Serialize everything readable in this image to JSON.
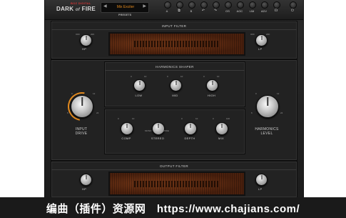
{
  "header": {
    "brand": "BOZ DIGITAL",
    "product": "DARK",
    "product_of": "of",
    "product_end": "FIRE",
    "preset": {
      "prev": "◀",
      "next": "▶",
      "name": "Mix Exciter",
      "label": "PRESETS"
    },
    "toolbar": [
      {
        "name": "a",
        "label": "A"
      },
      {
        "name": "copy",
        "label": "⧉"
      },
      {
        "name": "b",
        "label": "B"
      },
      {
        "name": "undo",
        "label": "↶"
      },
      {
        "name": "redo",
        "label": "↷"
      },
      {
        "name": "os",
        "label": "OS"
      },
      {
        "name": "agc",
        "label": "AGC"
      },
      {
        "name": "lim",
        "label": "LIM"
      },
      {
        "name": "adv",
        "label": "ADV"
      },
      {
        "name": "headphones",
        "label": "☊"
      },
      {
        "name": "power",
        "label": "⏻"
      }
    ]
  },
  "input_filter": {
    "title": "INPUT FILTER",
    "hp_label": "HP",
    "lp_label": "LP",
    "hp_ticks": [
      "OFF",
      "20K"
    ],
    "lp_ticks": [
      "OFF",
      "20K"
    ]
  },
  "harmonics_shaper": {
    "title": "HARMONICS SHAPER",
    "knobs": [
      {
        "label": "LOW",
        "ticks": [
          "0",
          "10"
        ]
      },
      {
        "label": "MID",
        "ticks": [
          "0",
          "10"
        ]
      },
      {
        "label": "HIGH",
        "ticks": [
          "0",
          "10"
        ]
      }
    ],
    "lower_knobs": [
      {
        "label": "COMP",
        "ticks": [
          "0",
          "10"
        ]
      },
      {
        "label": "STEREO",
        "ticks": [
          "MONO",
          "WIDE"
        ]
      },
      {
        "label": "DEPTH",
        "ticks": [
          "0",
          "10"
        ]
      },
      {
        "label": "MIX",
        "ticks": [
          "0",
          "100"
        ]
      }
    ]
  },
  "input_drive": {
    "label_line1": "INPUT",
    "label_line2": "DRIVE",
    "ticks": [
      "0",
      "12",
      "6",
      "24"
    ]
  },
  "harmonics_level": {
    "label_line1": "HARMONICS",
    "label_line2": "LEVEL",
    "ticks": [
      "0",
      "12",
      "6",
      "24"
    ]
  },
  "output_filter": {
    "title": "OUTPUT FILTER",
    "hp_label": "HP",
    "lp_label": "LP"
  },
  "watermark": {
    "text": "编曲（插件）资源网　https://www.chajians.com/"
  },
  "colors": {
    "accent": "#e38a1e",
    "panel": "#222222",
    "display": "#5a2a12"
  }
}
